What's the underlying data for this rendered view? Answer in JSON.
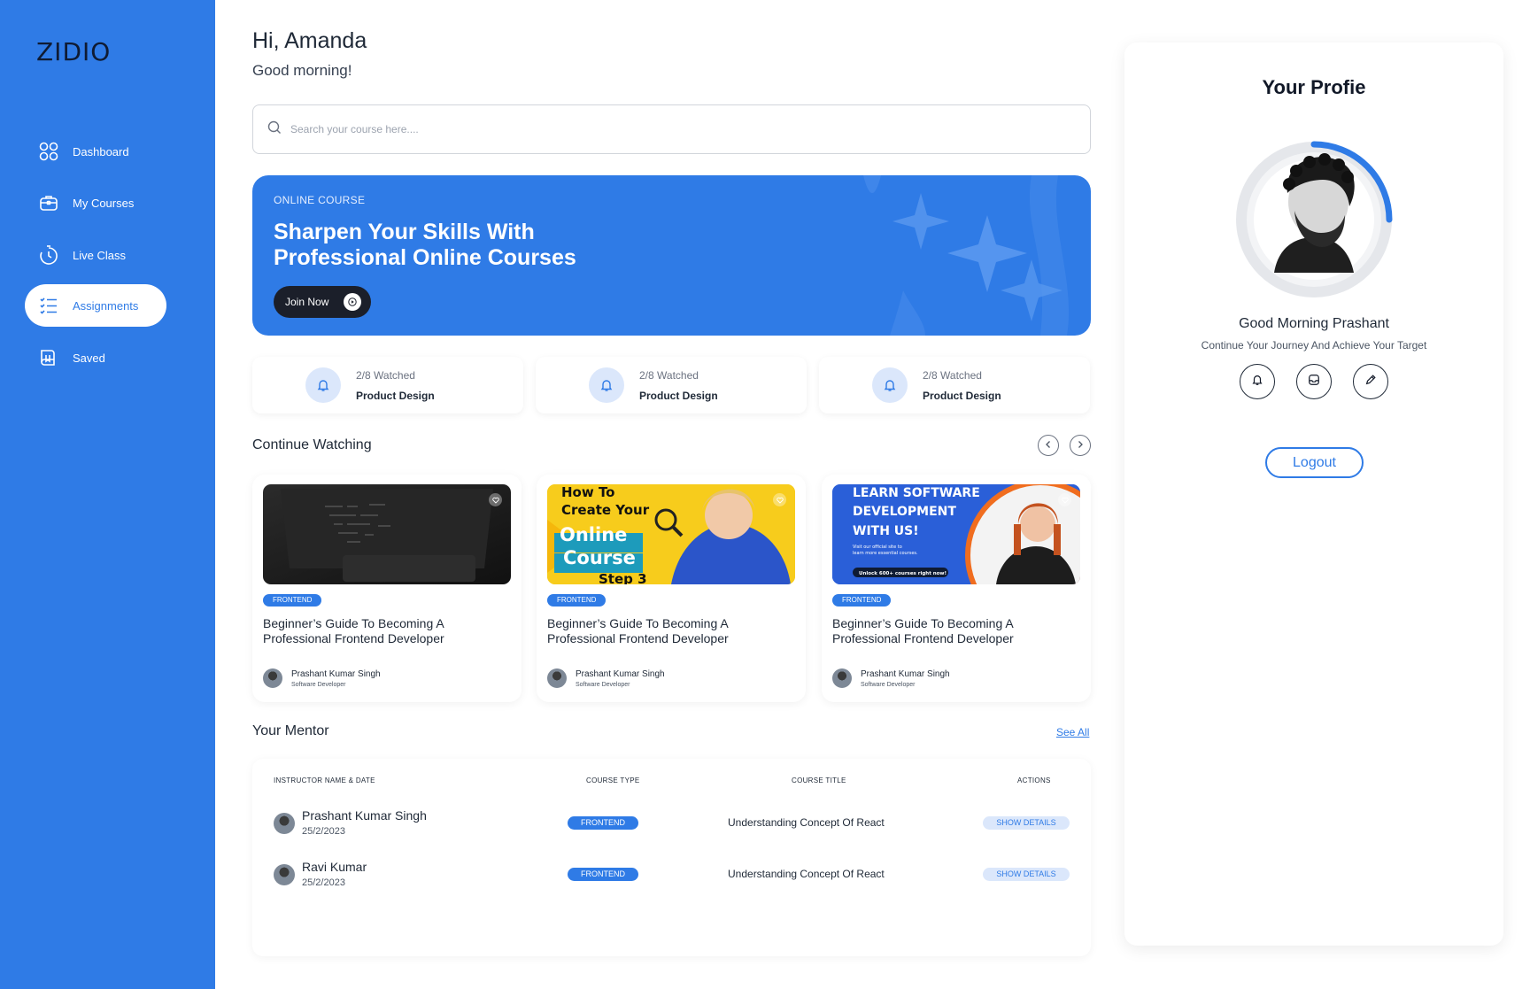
{
  "brand": {
    "logo": "ZIDIO",
    "accent": "#2f7be6"
  },
  "sidebar": {
    "items": [
      {
        "label": "Dashboard",
        "icon": "grid-icon"
      },
      {
        "label": "My Courses",
        "icon": "briefcase-icon"
      },
      {
        "label": "Live Class",
        "icon": "stopwatch-icon"
      },
      {
        "label": "Assignments",
        "icon": "checklist-icon",
        "active": true
      },
      {
        "label": "Saved",
        "icon": "book-icon"
      }
    ]
  },
  "header": {
    "greeting": "Hi, Amanda",
    "subgreeting": "Good morning!"
  },
  "search": {
    "placeholder": "Search your course here...."
  },
  "banner": {
    "tag": "ONLINE COURSE",
    "title": "Sharpen  Your Skills With Professional Online Courses",
    "button": "Join Now"
  },
  "stats": [
    {
      "watched": "2/8 Watched",
      "name": "Product Design"
    },
    {
      "watched": "2/8 Watched",
      "name": "Product Design"
    },
    {
      "watched": "2/8 Watched",
      "name": "Product Design"
    }
  ],
  "continue": {
    "title": "Continue Watching",
    "cards": [
      {
        "tag": "FRONTEND",
        "title": "Beginner’s Guide To Becoming A Professional Frontend Developer",
        "author": "Prashant Kumar Singh",
        "role": "Software Developer"
      },
      {
        "tag": "FRONTEND",
        "title": "Beginner’s Guide To Becoming A Professional Frontend Developer",
        "author": "Prashant Kumar Singh",
        "role": "Software Developer",
        "thumb_text": [
          "How To",
          "Create Your",
          "Online",
          "Course",
          "Step 3"
        ]
      },
      {
        "tag": "FRONTEND",
        "title": "Beginner’s Guide To Becoming A Professional Frontend Developer",
        "author": "Prashant Kumar Singh",
        "role": "Software Developer",
        "thumb_text": [
          "LEARN SOFTWARE",
          "DEVELOPMENT",
          "WITH US!",
          "Visit our official site to",
          "learn more essential courses.",
          "Unlock 600+ courses right now!"
        ]
      }
    ]
  },
  "mentor": {
    "title": "Your Mentor",
    "see_all": "See All",
    "columns": [
      "INSTRUCTOR NAME & DATE",
      "COURSE TYPE",
      "COURSE TITLE",
      "ACTIONS"
    ],
    "rows": [
      {
        "name": "Prashant Kumar Singh",
        "date": "25/2/2023",
        "type": "FRONTEND",
        "course": "Understanding Concept Of React",
        "action": "SHOW DETAILS"
      },
      {
        "name": "Ravi Kumar",
        "date": "25/2/2023",
        "type": "FRONTEND",
        "course": "Understanding Concept Of React",
        "action": "SHOW DETAILS"
      }
    ]
  },
  "profile": {
    "title": "Your Profie",
    "name": "Good Morning Prashant",
    "subtitle": "Continue Your Journey And Achieve Your Target",
    "buttons": [
      "bell-icon",
      "inbox-icon",
      "pencil-icon"
    ],
    "logout": "Logout"
  }
}
